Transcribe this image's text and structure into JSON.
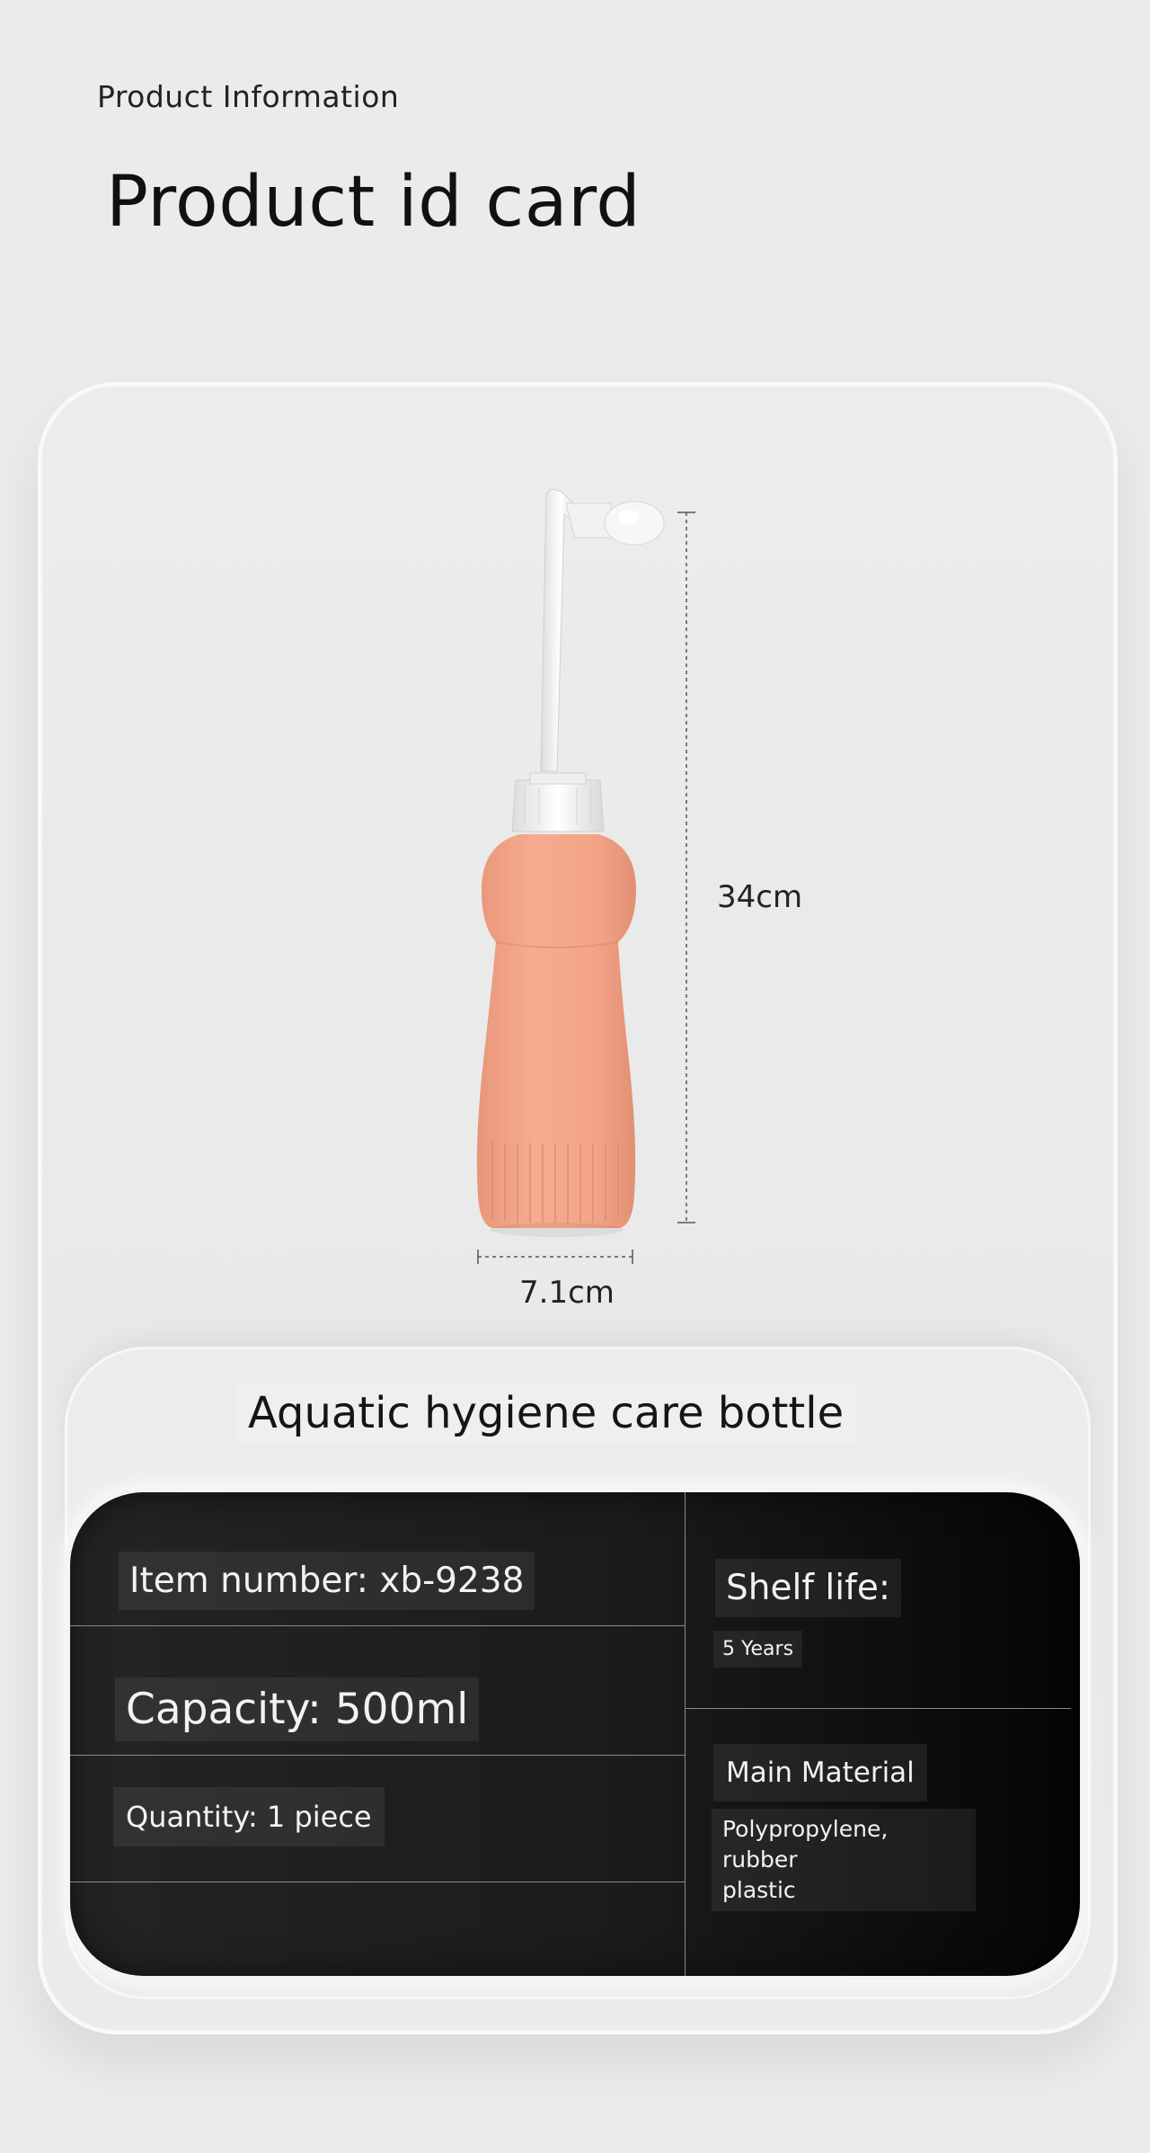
{
  "header": {
    "overline": "Product Information",
    "title": "Product id card"
  },
  "product": {
    "name": "Aquatic hygiene care bottle",
    "height_label": "34cm",
    "width_label": "7.1cm",
    "colors": {
      "body": "#f4a88a",
      "cap": "#f5f5f5"
    }
  },
  "specs": {
    "item_number": "Item number: xb-9238",
    "capacity": "Capacity: 500ml",
    "quantity": "Quantity: 1 piece",
    "shelf_life_label": "Shelf life:",
    "shelf_life_value": "5 Years",
    "material_label": "Main Material",
    "material_value_line1": "Polypropylene, rubber",
    "material_value_line2": "plastic"
  }
}
